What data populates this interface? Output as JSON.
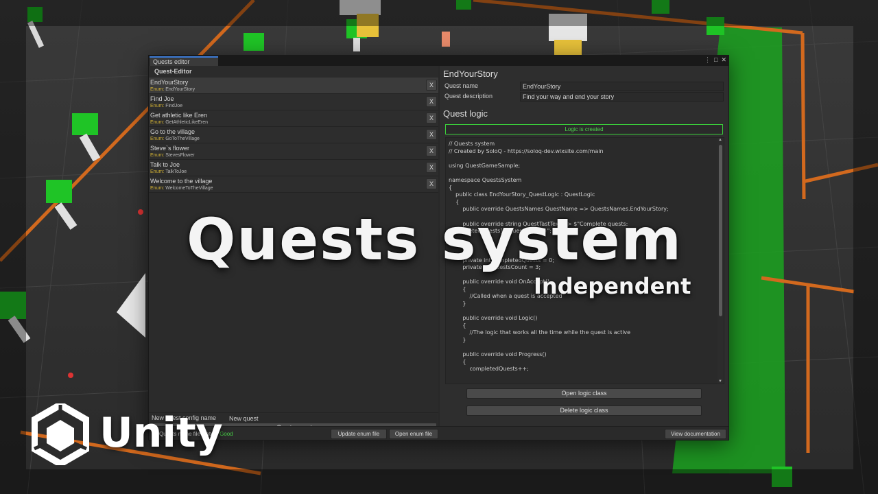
{
  "window": {
    "tab_title": "Quests editor",
    "controls": [
      "⋮",
      "□",
      "✕"
    ]
  },
  "left_panel": {
    "title": "Quest-Editor",
    "enum_prefix": "Enum:",
    "remove_label": "X",
    "quests": [
      {
        "name": "EndYourStory",
        "enum": "EndYourStory",
        "selected": true
      },
      {
        "name": "Find Joe",
        "enum": "FindJoe"
      },
      {
        "name": "Get athletic like Eren",
        "enum": "GetAthleticLikeEren"
      },
      {
        "name": "Go to the village",
        "enum": "GoToTheVillage"
      },
      {
        "name": "Steve`s flower",
        "enum": "StevesFlower"
      },
      {
        "name": "Talk to Joe",
        "enum": "TalkToJoe"
      },
      {
        "name": "Welcome to the village",
        "enum": "WelcomeToTheVillage"
      }
    ],
    "new_config_label": "New quest config name",
    "new_config_value": "New quest",
    "create_button": "Create quest"
  },
  "right_panel": {
    "heading": "EndYourStory",
    "quest_name_label": "Quest name",
    "quest_name_value": "EndYourStory",
    "quest_description_label": "Quest description",
    "quest_description_value": "Find your way and end your story",
    "logic_heading": "Quest logic",
    "logic_status": "Logic is created",
    "code": "// Quests system\n// Created by SoloQ - https://soloq-dev.wixsite.com/main\n\nusing QuestGameSample;\n\nnamespace QuestsSystem\n{\n    public class EndYourStory_QuestLogic : QuestLogic\n    {\n        public override QuestsNames QuestName => QuestsNames.EndYourStory;\n\n        public override string QuestTastText => $\"Complete quests:\n{completedQuests}/{questsCount}\";\n\n\n\n        private int completedQuests = 0;\n        private int questsCount = 3;\n\n        public override void OnAccept()\n        {\n            //Called when a quest is accepted\n        }\n\n        public override void Logic()\n        {\n            //The logic that works all the time while the quest is active\n        }\n\n        public override void Progress()\n        {\n            completedQuests++;",
    "open_logic_button": "Open logic class",
    "delete_logic_button": "Delete logic class"
  },
  "bottom_bar": {
    "status_label": "Quests name file status:",
    "status_value": "Good",
    "update_button": "Update enum file",
    "open_button": "Open enum file",
    "documentation_button": "View documentation"
  },
  "overlay": {
    "title": "Quests system",
    "subtitle": "Independent",
    "brand": "Unity"
  },
  "colors": {
    "accent_green": "#3bd13b",
    "enum_label": "#d3b233",
    "tab_accent": "#3c7bd6",
    "floor_grid_green": "#1ba320",
    "path_orange": "#d2691e"
  }
}
